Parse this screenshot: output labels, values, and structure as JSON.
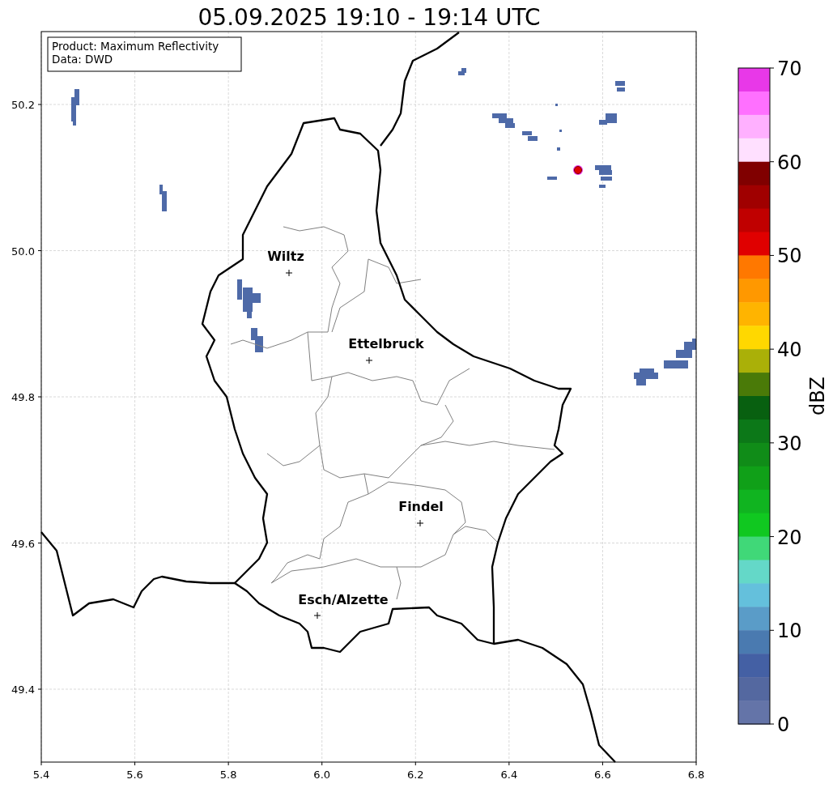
{
  "title": "05.09.2025 19:10 - 19:14 UTC",
  "info_box": [
    "Product: Maximum Reflectivity",
    "Data: DWD"
  ],
  "x_ticks": [
    "5.4",
    "5.6",
    "5.8",
    "6.0",
    "6.2",
    "6.4",
    "6.6",
    "6.8"
  ],
  "y_ticks": [
    "50.2",
    "50.0",
    "49.8",
    "49.6",
    "49.4"
  ],
  "cities": [
    {
      "name": "Wiltz"
    },
    {
      "name": "Ettelbruck"
    },
    {
      "name": "Findel"
    },
    {
      "name": "Esch/Alzette"
    }
  ],
  "colorbar": {
    "label": "dBZ",
    "ticks": [
      "70",
      "60",
      "50",
      "40",
      "30",
      "20",
      "10",
      "0"
    ],
    "bins": [
      {
        "color": "#e838e8"
      },
      {
        "color": "#ff70ff"
      },
      {
        "color": "#ffb0ff"
      },
      {
        "color": "#ffe0ff"
      },
      {
        "color": "#800000"
      },
      {
        "color": "#a00000"
      },
      {
        "color": "#c00000"
      },
      {
        "color": "#e00000"
      },
      {
        "color": "#ff7800"
      },
      {
        "color": "#ff9800"
      },
      {
        "color": "#ffb400"
      },
      {
        "color": "#ffd800"
      },
      {
        "color": "#aab008"
      },
      {
        "color": "#4a7a08"
      },
      {
        "color": "#086010"
      },
      {
        "color": "#0c7818"
      },
      {
        "color": "#108c18"
      },
      {
        "color": "#10a018"
      },
      {
        "color": "#10b420"
      },
      {
        "color": "#10c820"
      },
      {
        "color": "#40d878"
      },
      {
        "color": "#64d8c8"
      },
      {
        "color": "#64c0dc"
      },
      {
        "color": "#5a9cc8"
      },
      {
        "color": "#4a7ab0"
      },
      {
        "color": "#4460a4"
      },
      {
        "color": "#5468a0"
      },
      {
        "color": "#6474a8"
      }
    ]
  }
}
